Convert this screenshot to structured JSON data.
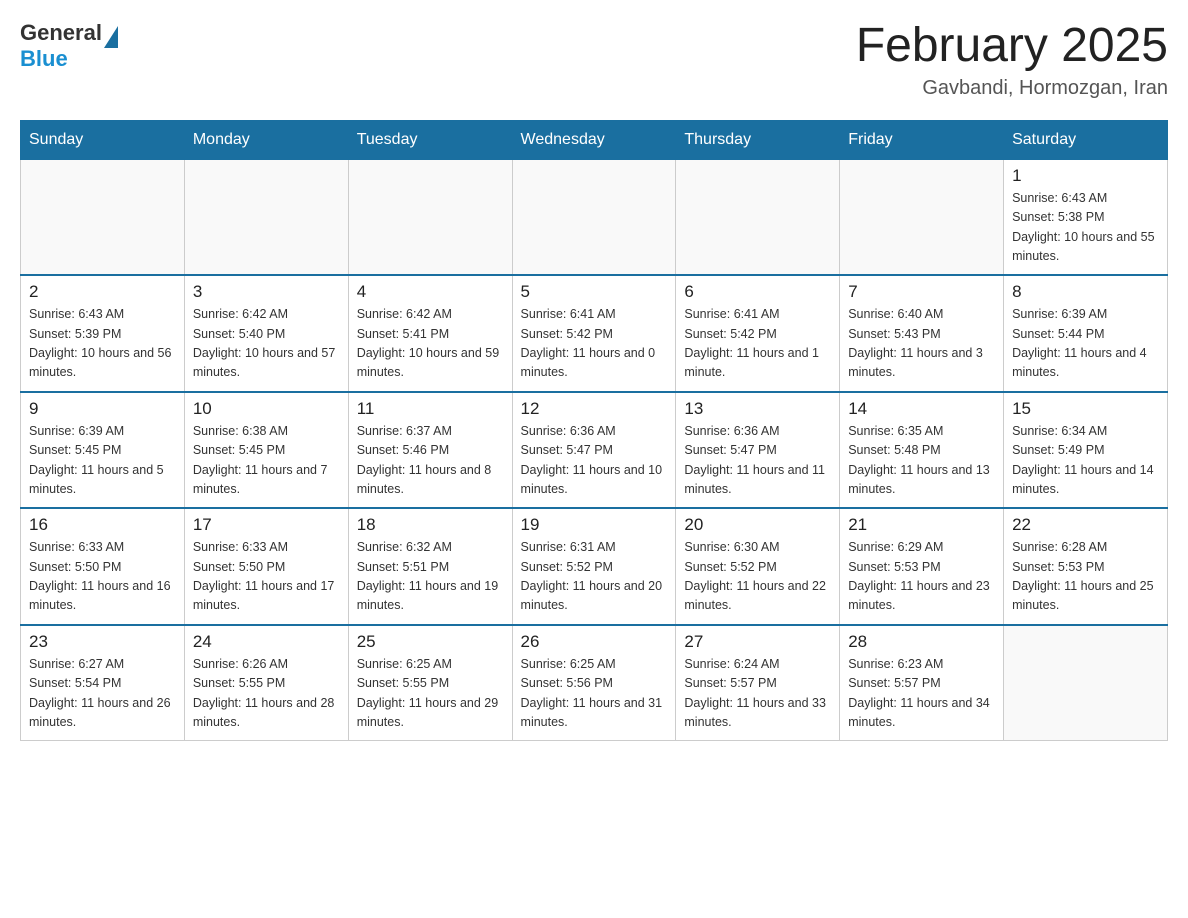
{
  "header": {
    "logo_general": "General",
    "logo_blue": "Blue",
    "title": "February 2025",
    "subtitle": "Gavbandi, Hormozgan, Iran"
  },
  "weekdays": [
    "Sunday",
    "Monday",
    "Tuesday",
    "Wednesday",
    "Thursday",
    "Friday",
    "Saturday"
  ],
  "weeks": [
    [
      {
        "day": "",
        "sunrise": "",
        "sunset": "",
        "daylight": "",
        "empty": true
      },
      {
        "day": "",
        "sunrise": "",
        "sunset": "",
        "daylight": "",
        "empty": true
      },
      {
        "day": "",
        "sunrise": "",
        "sunset": "",
        "daylight": "",
        "empty": true
      },
      {
        "day": "",
        "sunrise": "",
        "sunset": "",
        "daylight": "",
        "empty": true
      },
      {
        "day": "",
        "sunrise": "",
        "sunset": "",
        "daylight": "",
        "empty": true
      },
      {
        "day": "",
        "sunrise": "",
        "sunset": "",
        "daylight": "",
        "empty": true
      },
      {
        "day": "1",
        "sunrise": "Sunrise: 6:43 AM",
        "sunset": "Sunset: 5:38 PM",
        "daylight": "Daylight: 10 hours and 55 minutes.",
        "empty": false
      }
    ],
    [
      {
        "day": "2",
        "sunrise": "Sunrise: 6:43 AM",
        "sunset": "Sunset: 5:39 PM",
        "daylight": "Daylight: 10 hours and 56 minutes.",
        "empty": false
      },
      {
        "day": "3",
        "sunrise": "Sunrise: 6:42 AM",
        "sunset": "Sunset: 5:40 PM",
        "daylight": "Daylight: 10 hours and 57 minutes.",
        "empty": false
      },
      {
        "day": "4",
        "sunrise": "Sunrise: 6:42 AM",
        "sunset": "Sunset: 5:41 PM",
        "daylight": "Daylight: 10 hours and 59 minutes.",
        "empty": false
      },
      {
        "day": "5",
        "sunrise": "Sunrise: 6:41 AM",
        "sunset": "Sunset: 5:42 PM",
        "daylight": "Daylight: 11 hours and 0 minutes.",
        "empty": false
      },
      {
        "day": "6",
        "sunrise": "Sunrise: 6:41 AM",
        "sunset": "Sunset: 5:42 PM",
        "daylight": "Daylight: 11 hours and 1 minute.",
        "empty": false
      },
      {
        "day": "7",
        "sunrise": "Sunrise: 6:40 AM",
        "sunset": "Sunset: 5:43 PM",
        "daylight": "Daylight: 11 hours and 3 minutes.",
        "empty": false
      },
      {
        "day": "8",
        "sunrise": "Sunrise: 6:39 AM",
        "sunset": "Sunset: 5:44 PM",
        "daylight": "Daylight: 11 hours and 4 minutes.",
        "empty": false
      }
    ],
    [
      {
        "day": "9",
        "sunrise": "Sunrise: 6:39 AM",
        "sunset": "Sunset: 5:45 PM",
        "daylight": "Daylight: 11 hours and 5 minutes.",
        "empty": false
      },
      {
        "day": "10",
        "sunrise": "Sunrise: 6:38 AM",
        "sunset": "Sunset: 5:45 PM",
        "daylight": "Daylight: 11 hours and 7 minutes.",
        "empty": false
      },
      {
        "day": "11",
        "sunrise": "Sunrise: 6:37 AM",
        "sunset": "Sunset: 5:46 PM",
        "daylight": "Daylight: 11 hours and 8 minutes.",
        "empty": false
      },
      {
        "day": "12",
        "sunrise": "Sunrise: 6:36 AM",
        "sunset": "Sunset: 5:47 PM",
        "daylight": "Daylight: 11 hours and 10 minutes.",
        "empty": false
      },
      {
        "day": "13",
        "sunrise": "Sunrise: 6:36 AM",
        "sunset": "Sunset: 5:47 PM",
        "daylight": "Daylight: 11 hours and 11 minutes.",
        "empty": false
      },
      {
        "day": "14",
        "sunrise": "Sunrise: 6:35 AM",
        "sunset": "Sunset: 5:48 PM",
        "daylight": "Daylight: 11 hours and 13 minutes.",
        "empty": false
      },
      {
        "day": "15",
        "sunrise": "Sunrise: 6:34 AM",
        "sunset": "Sunset: 5:49 PM",
        "daylight": "Daylight: 11 hours and 14 minutes.",
        "empty": false
      }
    ],
    [
      {
        "day": "16",
        "sunrise": "Sunrise: 6:33 AM",
        "sunset": "Sunset: 5:50 PM",
        "daylight": "Daylight: 11 hours and 16 minutes.",
        "empty": false
      },
      {
        "day": "17",
        "sunrise": "Sunrise: 6:33 AM",
        "sunset": "Sunset: 5:50 PM",
        "daylight": "Daylight: 11 hours and 17 minutes.",
        "empty": false
      },
      {
        "day": "18",
        "sunrise": "Sunrise: 6:32 AM",
        "sunset": "Sunset: 5:51 PM",
        "daylight": "Daylight: 11 hours and 19 minutes.",
        "empty": false
      },
      {
        "day": "19",
        "sunrise": "Sunrise: 6:31 AM",
        "sunset": "Sunset: 5:52 PM",
        "daylight": "Daylight: 11 hours and 20 minutes.",
        "empty": false
      },
      {
        "day": "20",
        "sunrise": "Sunrise: 6:30 AM",
        "sunset": "Sunset: 5:52 PM",
        "daylight": "Daylight: 11 hours and 22 minutes.",
        "empty": false
      },
      {
        "day": "21",
        "sunrise": "Sunrise: 6:29 AM",
        "sunset": "Sunset: 5:53 PM",
        "daylight": "Daylight: 11 hours and 23 minutes.",
        "empty": false
      },
      {
        "day": "22",
        "sunrise": "Sunrise: 6:28 AM",
        "sunset": "Sunset: 5:53 PM",
        "daylight": "Daylight: 11 hours and 25 minutes.",
        "empty": false
      }
    ],
    [
      {
        "day": "23",
        "sunrise": "Sunrise: 6:27 AM",
        "sunset": "Sunset: 5:54 PM",
        "daylight": "Daylight: 11 hours and 26 minutes.",
        "empty": false
      },
      {
        "day": "24",
        "sunrise": "Sunrise: 6:26 AM",
        "sunset": "Sunset: 5:55 PM",
        "daylight": "Daylight: 11 hours and 28 minutes.",
        "empty": false
      },
      {
        "day": "25",
        "sunrise": "Sunrise: 6:25 AM",
        "sunset": "Sunset: 5:55 PM",
        "daylight": "Daylight: 11 hours and 29 minutes.",
        "empty": false
      },
      {
        "day": "26",
        "sunrise": "Sunrise: 6:25 AM",
        "sunset": "Sunset: 5:56 PM",
        "daylight": "Daylight: 11 hours and 31 minutes.",
        "empty": false
      },
      {
        "day": "27",
        "sunrise": "Sunrise: 6:24 AM",
        "sunset": "Sunset: 5:57 PM",
        "daylight": "Daylight: 11 hours and 33 minutes.",
        "empty": false
      },
      {
        "day": "28",
        "sunrise": "Sunrise: 6:23 AM",
        "sunset": "Sunset: 5:57 PM",
        "daylight": "Daylight: 11 hours and 34 minutes.",
        "empty": false
      },
      {
        "day": "",
        "sunrise": "",
        "sunset": "",
        "daylight": "",
        "empty": true
      }
    ]
  ]
}
